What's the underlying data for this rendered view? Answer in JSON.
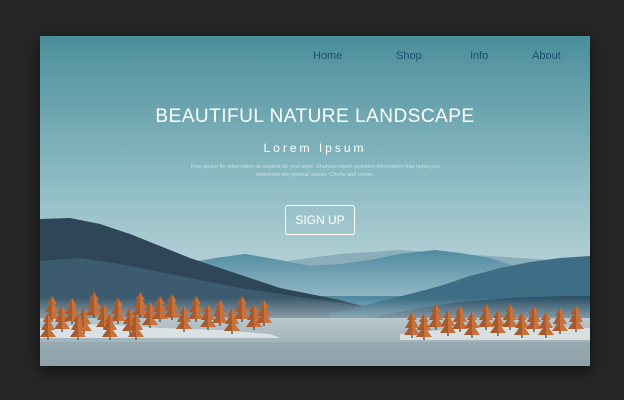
{
  "nav": {
    "items": [
      {
        "label": "Home"
      },
      {
        "label": "Shop"
      },
      {
        "label": "Info"
      },
      {
        "label": "About"
      }
    ]
  },
  "hero": {
    "title": "BEAUTIFUL NATURE LANDSCAPE",
    "subtitle": "Lorem Ipsum",
    "body_line_1": "Free space for information to expand on your topic. Analysis report provides information that helps you",
    "body_line_2": "determine the optimal values. Charts and colors.",
    "cta_label": "SIGN UP"
  },
  "colors": {
    "sky_top": "#4a8e9b",
    "sky_bottom": "#dfe7ea",
    "nav_text": "#1f4f73",
    "mountain_dark": "#2e4658",
    "mountain_mid": "#3d6e85",
    "tree_orange": "#c9713b",
    "water": "#a7b8bf",
    "page_frame": "#262626"
  }
}
